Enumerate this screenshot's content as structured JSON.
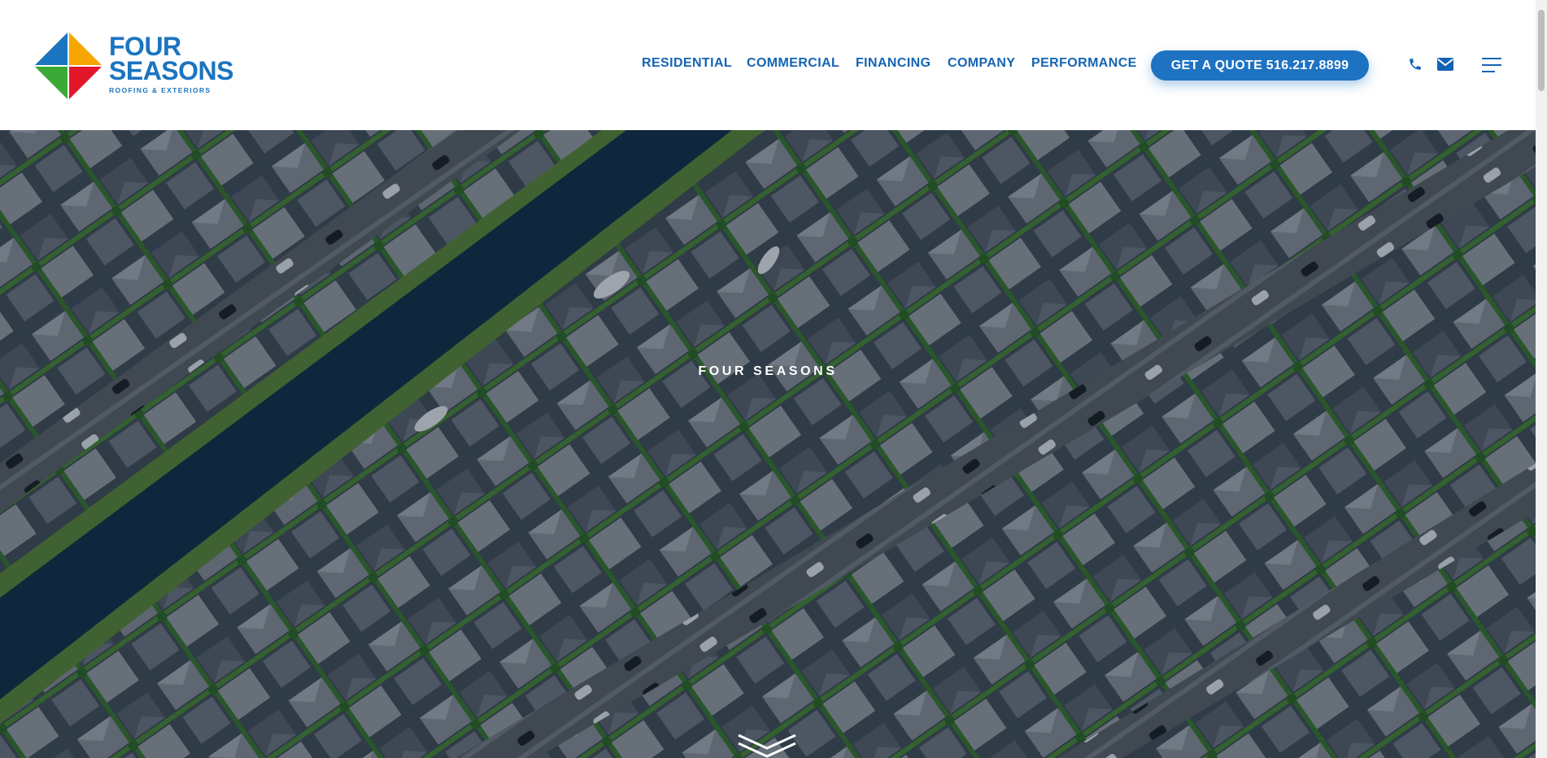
{
  "brand": {
    "name_line1": "FOUR",
    "name_line2": "SEASONS",
    "tagline": "ROOFING & EXTERIORS",
    "color": "#1b74c0",
    "logo_colors": [
      "#1b74c0",
      "#f7a600",
      "#e2162b",
      "#3aa935"
    ]
  },
  "nav": {
    "items": [
      {
        "label": "RESIDENTIAL"
      },
      {
        "label": "COMMERCIAL"
      },
      {
        "label": "FINANCING"
      },
      {
        "label": "COMPANY"
      },
      {
        "label": "PERFORMANCE"
      }
    ],
    "cta_label": "GET A QUOTE 516.217.8899",
    "icons": [
      "phone-icon",
      "mail-icon",
      "menu-icon"
    ]
  },
  "hero": {
    "title": "FOUR SEASONS",
    "scroll_icon": "chevron-down-icon"
  },
  "colors": {
    "nav_text": "#1464b4",
    "cta_bg": "#1e72c2",
    "overlay": "rgba(10,20,35,0.35)"
  }
}
